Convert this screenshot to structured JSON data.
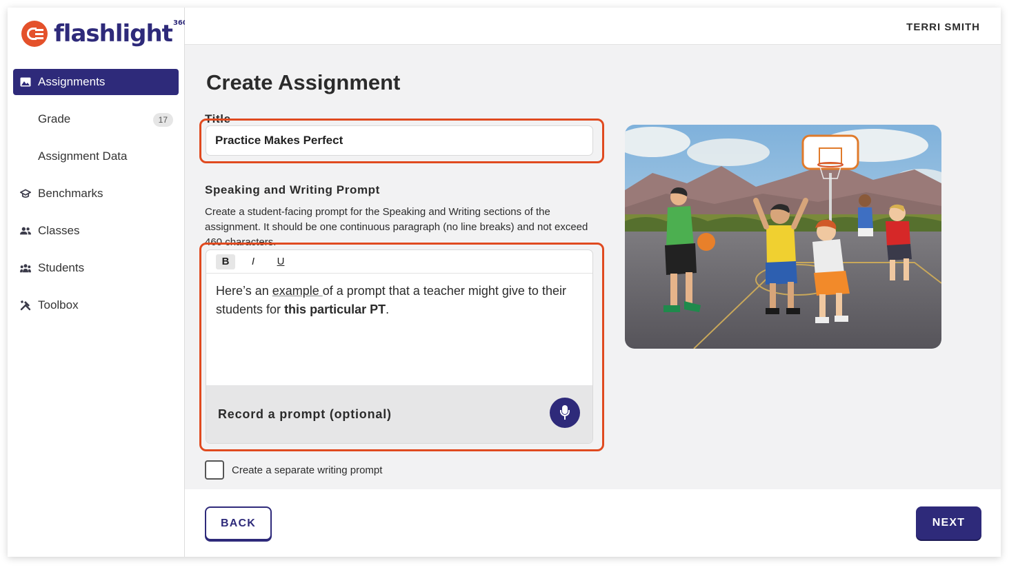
{
  "app": {
    "logo_text": "flashlight",
    "logo_sup": "360"
  },
  "header": {
    "user_name": "TERRI SMITH"
  },
  "sidebar": {
    "items": [
      {
        "label": "Assignments",
        "icon": "image-icon",
        "active": true
      },
      {
        "label": "Grade",
        "badge": "17"
      },
      {
        "label": "Assignment Data"
      },
      {
        "label": "Benchmarks",
        "icon": "graduation-cap-icon"
      },
      {
        "label": "Classes",
        "icon": "people-icon"
      },
      {
        "label": "Students",
        "icon": "group-icon"
      },
      {
        "label": "Toolbox",
        "icon": "tools-icon"
      }
    ]
  },
  "main": {
    "page_title": "Create Assignment",
    "title_label": "Title",
    "title_value": "Practice Makes Perfect",
    "prompt_label": "Speaking and Writing Prompt",
    "prompt_help": "Create a student-facing prompt for the Speaking and Writing sections of the assignment. It should be one continuous paragraph (no line breaks) and not exceed 460 characters.",
    "toolbar": {
      "bold": "B",
      "italic": "I",
      "underline": "U"
    },
    "editor": {
      "part1": "Here’s an ",
      "link": "example ",
      "part2": "of a prompt that a teacher might give to their students for ",
      "bold": "this particular PT",
      "part3": "."
    },
    "record_label": "Record a prompt (optional)",
    "separate_prompt_label": "Create a separate writing prompt",
    "separate_prompt_checked": false
  },
  "footer": {
    "back_label": "BACK",
    "next_label": "NEXT"
  },
  "colors": {
    "brand": "#2e2a7a",
    "accent": "#e04a1f",
    "logo": "#e4512b"
  }
}
